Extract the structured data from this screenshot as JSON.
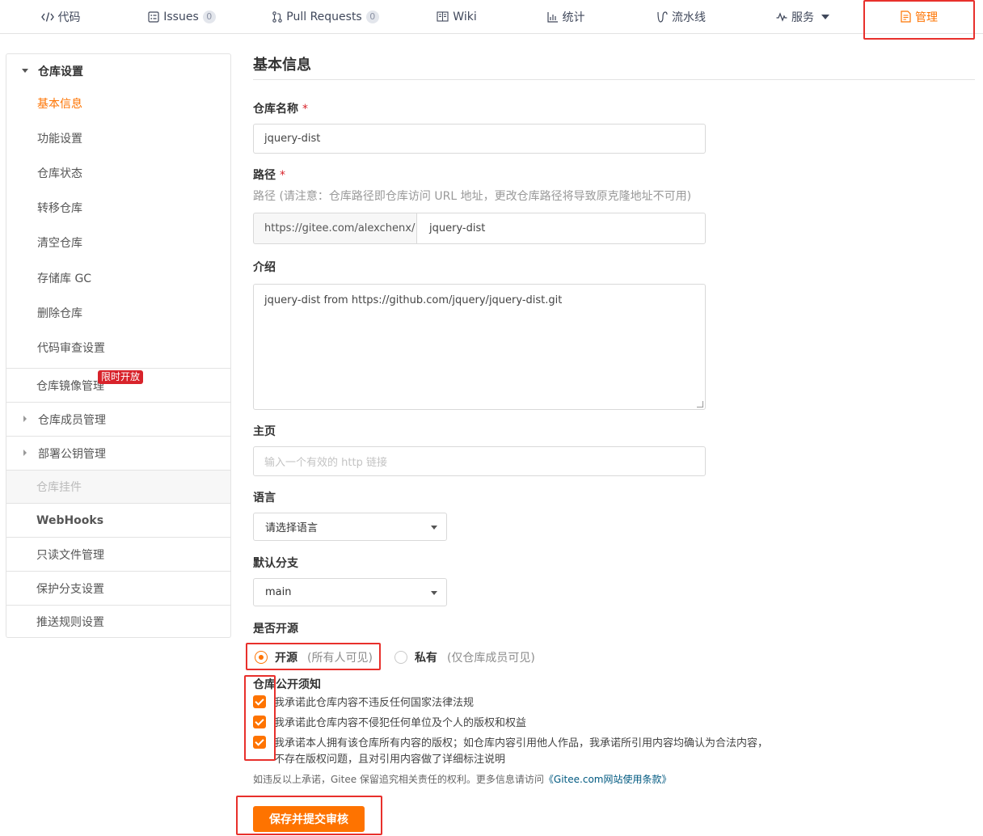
{
  "nav": {
    "tabs": [
      {
        "label": "代码",
        "icon": "code-icon"
      },
      {
        "label": "Issues",
        "count": "0",
        "icon": "issues-icon"
      },
      {
        "label": "Pull Requests",
        "count": "0",
        "icon": "pull-request-icon"
      },
      {
        "label": "Wiki",
        "icon": "wiki-icon"
      },
      {
        "label": "统计",
        "icon": "stats-icon"
      },
      {
        "label": "流水线",
        "icon": "pipeline-icon"
      },
      {
        "label": "服务",
        "icon": "service-icon"
      },
      {
        "label": "管理",
        "icon": "manage-icon",
        "active": true
      }
    ]
  },
  "sidebar": {
    "section": "仓库设置",
    "sub_items": [
      "基本信息",
      "功能设置",
      "仓库状态",
      "转移仓库",
      "清空仓库",
      "存储库 GC",
      "删除仓库",
      "代码审查设置"
    ],
    "mirror": {
      "label": "仓库镜像管理",
      "badge": "限时开放"
    },
    "members": "仓库成员管理",
    "deploy_keys": "部署公钥管理",
    "plugins": "仓库挂件",
    "webhooks": "WebHooks",
    "readonly_files": "只读文件管理",
    "protected_branches": "保护分支设置",
    "push_rules": "推送规则设置"
  },
  "form": {
    "title": "基本信息",
    "name_label": "仓库名称",
    "required_mark": "*",
    "name_value": "jquery-dist",
    "path_label": "路径",
    "path_hint": "路径 (请注意：仓库路径即仓库访问 URL 地址，更改仓库路径将导致原克隆地址不可用)",
    "path_prefix": "https://gitee.com/alexchenx/",
    "path_value": "jquery-dist",
    "desc_label": "介绍",
    "desc_value": "jquery-dist from https://github.com/jquery/jquery-dist.git",
    "homepage_label": "主页",
    "homepage_placeholder": "输入一个有效的 http 链接",
    "language_label": "语言",
    "language_value": "请选择语言",
    "branch_label": "默认分支",
    "branch_value": "main",
    "visibility_label": "是否开源",
    "open_label": "开源",
    "open_hint": "(所有人可见)",
    "private_label": "私有",
    "private_hint": "(仅仓库成员可见)",
    "notice_label": "仓库公开须知",
    "pledge_1": "我承诺此仓库内容不违反任何国家法律法规",
    "pledge_2": "我承诺此仓库内容不侵犯任何单位及个人的版权和权益",
    "pledge_3_line1": "我承诺本人拥有该仓库所有内容的版权；如仓库内容引用他人作品，我承诺所引用内容均确认为合法内容，",
    "pledge_3_line2": "不存在版权问题，且对引用内容做了详细标注说明",
    "footnote": "如违反以上承诺，Gitee 保留追究相关责任的权利。更多信息请访问",
    "footnote_link": "《Gitee.com网站使用条款》",
    "submit_label": "保存并提交审核"
  },
  "colors": {
    "accent": "#fe7300",
    "highlight": "#e8302c",
    "badge": "#d8232b"
  }
}
